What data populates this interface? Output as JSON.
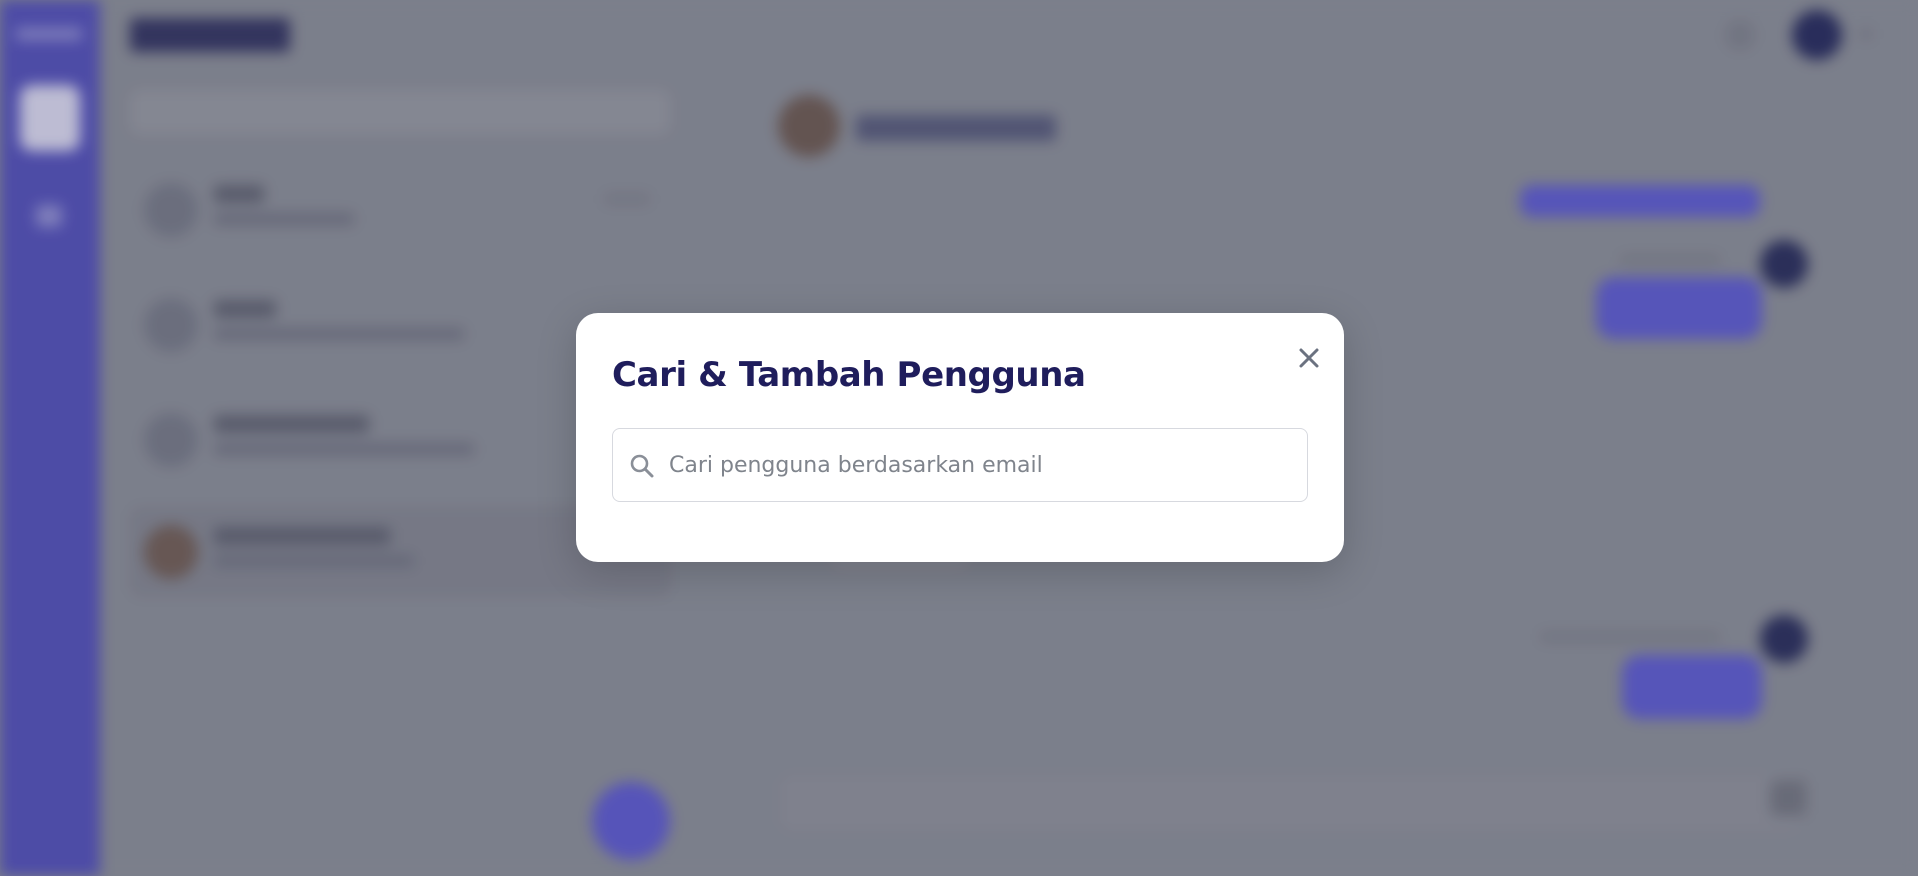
{
  "modal": {
    "title": "Cari & Tambah Pengguna",
    "search": {
      "placeholder": "Cari pengguna berdasarkan email",
      "value": ""
    },
    "close_icon": "close-icon",
    "search_icon": "search-icon"
  },
  "colors": {
    "accent": "#4f4db8",
    "title": "#1f1d5c",
    "overlay": "#888c97",
    "bubble": "#5a58cf"
  }
}
